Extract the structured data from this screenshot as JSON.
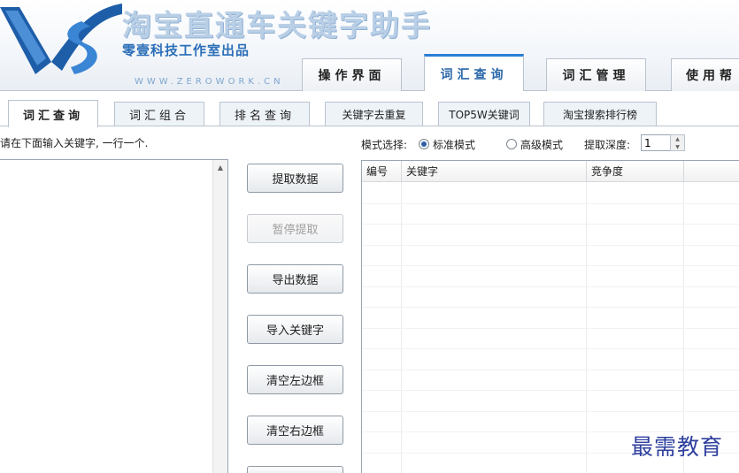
{
  "header": {
    "title": "淘宝直通车关键字助手",
    "subtitle": "零壹科技工作室出品",
    "url": "WWW.ZEROWORK.CN"
  },
  "main_tabs": [
    {
      "label": "操作界面"
    },
    {
      "label": "词汇查询"
    },
    {
      "label": "词汇管理"
    },
    {
      "label": "使用帮"
    }
  ],
  "sub_tabs": [
    {
      "label": "词汇查询"
    },
    {
      "label": "词汇组合"
    },
    {
      "label": "排名查询"
    },
    {
      "label": "关键字去重复"
    },
    {
      "label": "TOP5W关键词"
    },
    {
      "label": "淘宝搜索排行榜"
    }
  ],
  "left": {
    "instruction": "请在下面输入关键字, 一行一个.",
    "keywords_value": ""
  },
  "buttons": {
    "fetch": "提取数据",
    "pause": "暂停提取",
    "export": "导出数据",
    "import": "导入关键字",
    "clear_left": "清空左边框",
    "clear_right": "清空右边框"
  },
  "mode": {
    "label": "模式选择:",
    "standard": "标准模式",
    "advanced": "高级模式",
    "selected": "standard",
    "depth_label": "提取深度:",
    "depth_value": "1"
  },
  "grid": {
    "columns": [
      "编号",
      "关键字",
      "竞争度"
    ],
    "rows": []
  },
  "watermark": "最需教育",
  "colors": {
    "accent": "#2a7fd4",
    "title": "#b9cfe6",
    "subtitle": "#2c6fb8",
    "watermark": "#2e3f9e"
  }
}
